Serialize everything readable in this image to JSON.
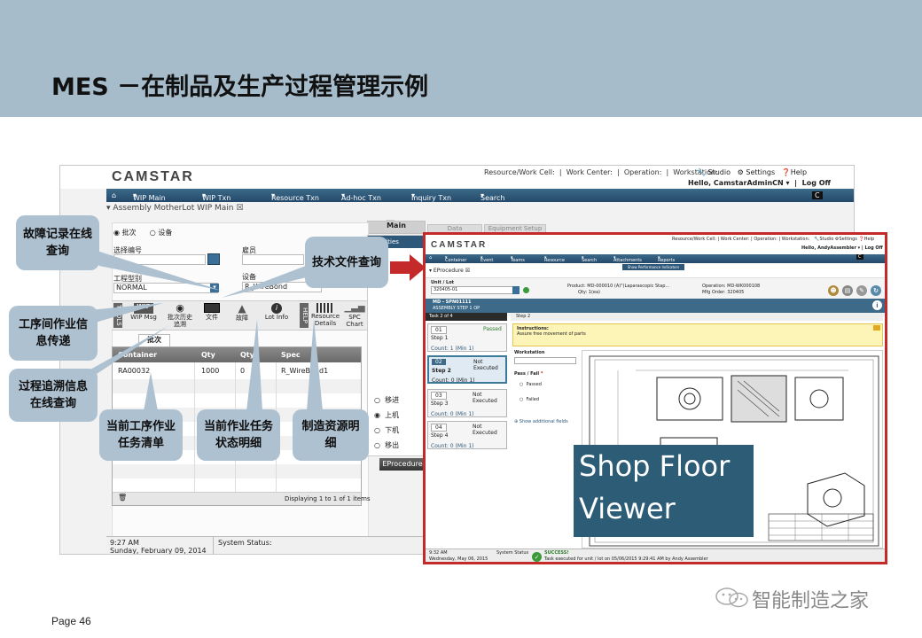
{
  "slide": {
    "title": "MES －在制品及生产过程管理示例",
    "page_number": "Page 46",
    "watermark": "智能制造之家"
  },
  "left_app": {
    "logo": "CAMSTAR",
    "top_info": [
      "Resource/Work Cell:",
      "Work Center:",
      "Operation:",
      "Workstation:"
    ],
    "top_links": {
      "studio": "Studio",
      "settings": "Settings",
      "help": "Help"
    },
    "user": "Hello, CamstarAdminCN",
    "logoff": "Log Off",
    "nav": [
      "WIP Main",
      "WIP Txn",
      "Resource Txn",
      "Ad-hoc Txn",
      "Inquiry Txn",
      "Search"
    ],
    "breadcrumb": "Assembly MotherLot WIP Main",
    "right_tabs": [
      "Main",
      "Data",
      "Equipment Setup"
    ],
    "radios": [
      "批次",
      "设备"
    ],
    "selected_radio": "批次",
    "fields": {
      "lot_label": "选择编号",
      "employee_label": "雇员",
      "type_label": "工程型别",
      "type_value": "NORMAL",
      "equipment_label": "设备",
      "equipment_value": "R_WireBond"
    },
    "toolbar": [
      "WIP Msg",
      "批次历史追溯",
      "文件",
      "故障",
      "Lot Info",
      "Resource Details",
      "SPC Chart"
    ],
    "wip_badge": "WIP",
    "side_tab_left": "TOOLS",
    "side_tab_right": "HELP",
    "table_tab": "批次",
    "table": {
      "headers": [
        "Container",
        "Qty",
        "Qty2",
        "Spec"
      ],
      "rows": [
        [
          "RA00032",
          "1000",
          "0",
          "R_WireBond1"
        ]
      ]
    },
    "footer_count": "Displaying 1 to 1 of 1 items",
    "move_options": [
      "移进",
      "上机",
      "下机",
      "移出"
    ],
    "eprocedure_btn": "EProcedure",
    "activities_label": "Activities",
    "status_time": "9:27 AM",
    "status_date": "Sunday, February 09, 2014",
    "system_status": "System Status:"
  },
  "callouts": {
    "fault": "故障记录在线查询",
    "tech_doc": "技术文件查询",
    "info_transfer": "工序间作业信息传递",
    "trace": "过程追溯信息在线查询",
    "task_list": "当前工序作业任务清单",
    "task_status": "当前作业任务状态明细",
    "resource": "制造资源明细"
  },
  "right_app": {
    "logo": "CAMSTAR",
    "top_info": [
      "Resource/Work Cell:",
      "Work Center:",
      "Operation:",
      "Workstation:"
    ],
    "top_links": {
      "studio": "Studio",
      "settings": "Settings",
      "help": "Help"
    },
    "user": "Hello, AndyAssembler",
    "logoff": "Log Off",
    "nav": [
      "Container",
      "Event",
      "Teams",
      "Resource",
      "Search",
      "Attachments",
      "Reports"
    ],
    "perf_tab": "Show Performance Indicators",
    "breadcrumb": "EProcedure",
    "unit_label": "Unit / Lot",
    "unit_value": "320405-01",
    "product": "Product: MD-000010 (A)\"(Laparascopic Stap...",
    "qty": "Qty: 1(ea)",
    "operation": "Operation: MD-WK000108",
    "mfg_order": "Mfg Order: 320405",
    "assembly_bar": "MD - SPN01111",
    "assembly_sub": "ASSEMBLY STEP 1 OP",
    "task_tabs": [
      "Task 2 of 4",
      "Step 2"
    ],
    "steps": [
      {
        "id": "01",
        "status": "Passed",
        "name": "Step 1",
        "count": "Count: 1 (Min 1)"
      },
      {
        "id": "02",
        "status": "Not Executed",
        "name": "Step 2",
        "count": "Count: 0 (Min 1)"
      },
      {
        "id": "03",
        "status": "Not Executed",
        "name": "Step 3",
        "count": "Count: 0 (Min 1)"
      },
      {
        "id": "04",
        "status": "Not Executed",
        "name": "Step 4",
        "count": "Count: 0 (Min 1)"
      }
    ],
    "instructions_title": "Instructions:",
    "instructions_text": "Assure free movement of parts",
    "workstation_label": "Workstation",
    "passfail_label": "Pass / Fail",
    "options": [
      "Passed",
      "Failed"
    ],
    "additional": "Show additional fields",
    "status_time": "9:32 AM",
    "status_date": "Wednesday, May 06, 2015",
    "system_status": "System Status",
    "success": "SUCCESS!",
    "success_text": "Task executed for unit / lot on 05/06/2015 9:29:41 AM by Andy Assembler"
  },
  "overlay": {
    "line1": "Shop Floor",
    "line2": "Viewer"
  },
  "colors": {
    "title_band": "#a7bccb",
    "callout": "#aec1d0",
    "frame": "#c42a2a",
    "nav": "#2e587a",
    "overlay": "#2d5c77"
  }
}
